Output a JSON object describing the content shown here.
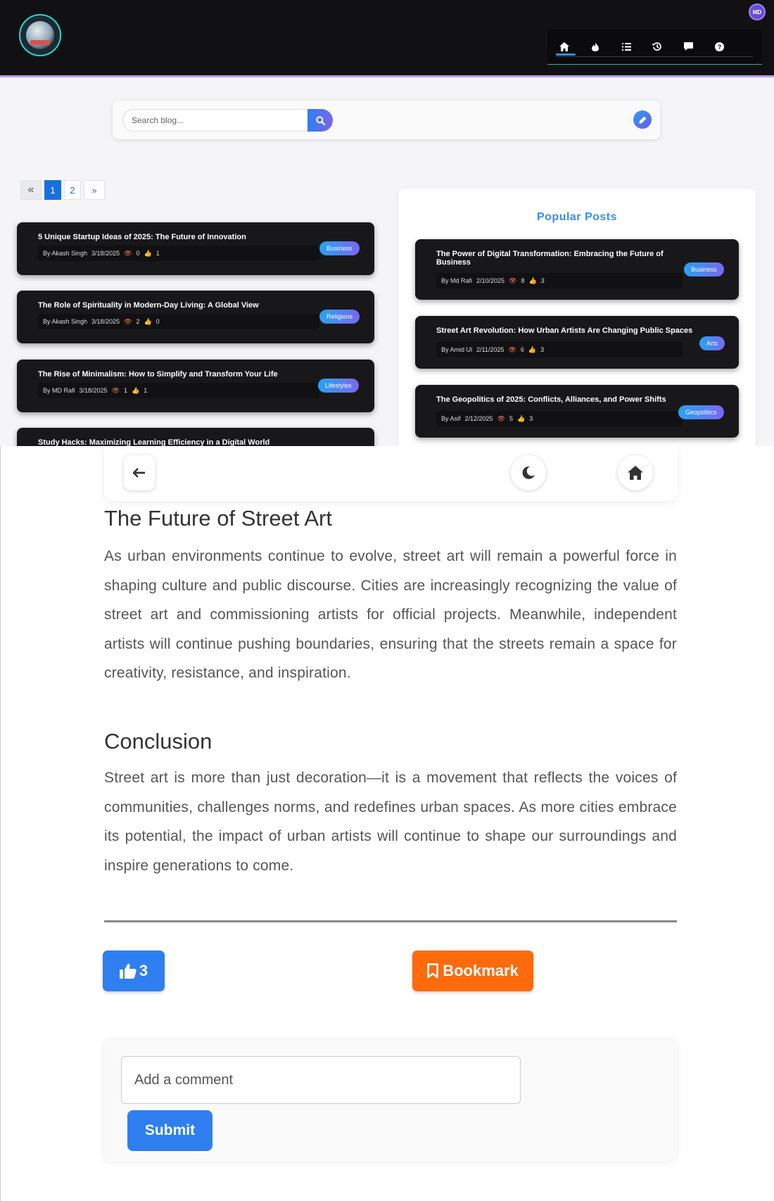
{
  "header": {
    "avatar_initials": "MD",
    "nav_icons": [
      "home-icon",
      "fire-icon",
      "list-icon",
      "history-icon",
      "comment-icon",
      "help-icon"
    ]
  },
  "search": {
    "placeholder": "Search blog..."
  },
  "pagination": {
    "first": "«",
    "pages": [
      "1",
      "2"
    ],
    "next": "»",
    "current": "1"
  },
  "posts": [
    {
      "title": "5 Unique Startup Ideas of 2025: The Future of Innovation",
      "author": "By Akash Singh",
      "date": "3/18/2025",
      "views": "0",
      "likes": "1",
      "category": "Business"
    },
    {
      "title": "The Role of Spirituality in Modern-Day Living: A Global View",
      "author": "By Akash Singh",
      "date": "3/18/2025",
      "views": "2",
      "likes": "0",
      "category": "Religions"
    },
    {
      "title": "The Rise of Minimalism: How to Simplify and Transform Your Life",
      "author": "By MD Rafi",
      "date": "3/18/2025",
      "views": "1",
      "likes": "1",
      "category": "Lifestyles"
    },
    {
      "title": "Study Hacks: Maximizing Learning Efficiency in a Digital World"
    }
  ],
  "popular": {
    "title": "Popular Posts",
    "posts": [
      {
        "title": "The Power of Digital Transformation: Embracing the Future of Business",
        "author": "By Md Rafi",
        "date": "2/10/2025",
        "views": "8",
        "likes": "3",
        "category": "Business"
      },
      {
        "title": "Street Art Revolution: How Urban Artists Are Changing Public Spaces",
        "author": "By Amid Ul",
        "date": "2/11/2025",
        "views": "6",
        "likes": "3",
        "category": "Arts"
      },
      {
        "title": "The Geopolitics of 2025: Conflicts, Alliances, and Power Shifts",
        "author": "By Asif",
        "date": "2/12/2025",
        "views": "5",
        "likes": "3",
        "category": "Geopolitics"
      }
    ]
  },
  "article": {
    "section1_heading": "The Future of Street Art",
    "section1_text": "As urban environments continue to evolve, street art will remain a powerful force in shaping culture and public discourse. Cities are increasingly recognizing the value of street art and commissioning artists for official projects. Meanwhile, independent artists will continue pushing boundaries, ensuring that the streets remain a space for creativity, resistance, and inspiration.",
    "section2_heading": "Conclusion",
    "section2_text": "Street art is more than just decoration—it is a movement that reflects the voices of communities, challenges norms, and redefines urban spaces. As more cities embrace its potential, the impact of urban artists will continue to shape our surroundings and inspire generations to come."
  },
  "actions": {
    "like_count": "3",
    "bookmark_label": "Bookmark"
  },
  "comment": {
    "placeholder": "Add a comment",
    "submit_label": "Submit"
  },
  "colors": {
    "accent": "#2f7ff0",
    "bookmark": "#ff6a0d",
    "popular_title": "#3a8df0",
    "card_bg": "#18181b"
  }
}
